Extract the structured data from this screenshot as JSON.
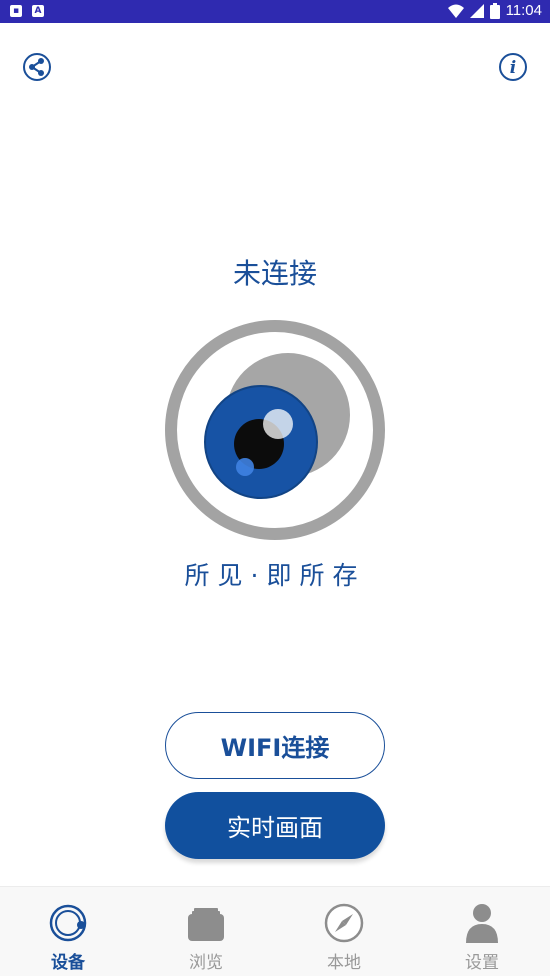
{
  "status_bar": {
    "time": "11:04",
    "notification_icons": [
      "android-icon",
      "a-icon"
    ]
  },
  "header": {
    "left_icon": "share-nodes-icon",
    "right_icon": "info-icon"
  },
  "main": {
    "connection_status": "未连接",
    "slogan": "所见·即所存",
    "wifi_button_label": "WIFI连接",
    "live_button_label": "实时画面"
  },
  "tabs": [
    {
      "label": "设备",
      "icon": "device-icon",
      "active": true
    },
    {
      "label": "浏览",
      "icon": "album-icon",
      "active": false
    },
    {
      "label": "本地",
      "icon": "compass-icon",
      "active": false
    },
    {
      "label": "设置",
      "icon": "user-icon",
      "active": false
    }
  ],
  "colors": {
    "status_bar": "#2f2ab0",
    "accent": "#1a4f99",
    "button_fill": "#11509e",
    "inactive": "#999999"
  }
}
